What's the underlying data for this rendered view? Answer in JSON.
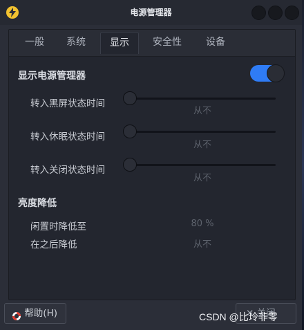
{
  "window": {
    "title": "电源管理器"
  },
  "tabs": [
    {
      "label": "一般"
    },
    {
      "label": "系统"
    },
    {
      "label": "显示"
    },
    {
      "label": "安全性"
    },
    {
      "label": "设备"
    }
  ],
  "active_tab": "显示",
  "display_section": {
    "title": "显示电源管理器",
    "toggle_on": true,
    "rows": [
      {
        "label": "转入黑屏状态时间",
        "value": "从不",
        "level": 0
      },
      {
        "label": "转入休眠状态时间",
        "value": "从不",
        "level": 0
      },
      {
        "label": "转入关闭状态时间",
        "value": "从不",
        "level": 0
      }
    ]
  },
  "brightness_section": {
    "title": "亮度降低",
    "rows": [
      {
        "label": "闲置时降低至",
        "value": "80 %"
      },
      {
        "label": "在之后降低",
        "value": "从不"
      }
    ]
  },
  "buttons": {
    "help": "帮助(H)",
    "close": "关闭"
  },
  "watermark": "CSDN @比玲非零",
  "colors": {
    "accent": "#2f7cf6",
    "app_icon": "#f2c230"
  }
}
